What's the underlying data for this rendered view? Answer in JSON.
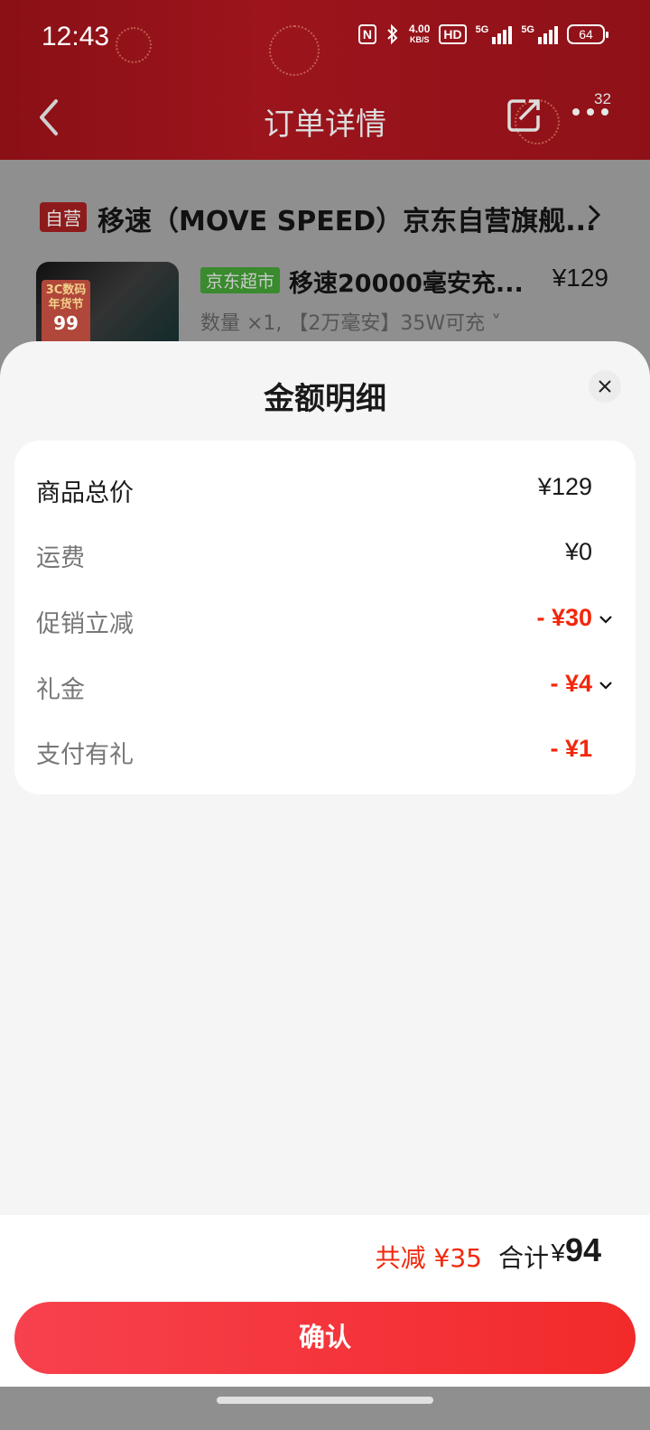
{
  "status_bar": {
    "time": "12:43",
    "nfc": "N",
    "speed_value": "4.00",
    "speed_unit": "KB/S",
    "hd": "HD",
    "sim1": "5G",
    "sim2": "5G",
    "battery": "64"
  },
  "nav": {
    "title": "订单详情",
    "badge": "32"
  },
  "order": {
    "shop_tag": "自营",
    "shop_name": "移速（MOVE SPEED）京东自营旗舰...",
    "product_tag": "京东超市",
    "product_name": "移速20000毫安充...",
    "product_price": "¥129",
    "product_spec": "数量 ×1, 【2万毫安】35W可充 ˅",
    "image_promo_text": "3C数码 年货节",
    "image_promo_number": "99"
  },
  "sheet": {
    "title": "金额明细",
    "rows": [
      {
        "label": "商品总价",
        "value": "¥129"
      },
      {
        "label": "运费",
        "value": "¥0"
      },
      {
        "label": "促销立减",
        "value": "- ¥30"
      },
      {
        "label": "礼金",
        "value": "- ¥4"
      },
      {
        "label": "支付有礼",
        "value": "- ¥1"
      }
    ],
    "total_saving": "共减 ¥35",
    "total_label": "合计",
    "total_currency": "¥",
    "total_amount": "94",
    "confirm_label": "确认"
  },
  "colors": {
    "accent_red": "#f2270c",
    "header_red": "#9c141c",
    "button_gradient_start": "#f7414e",
    "button_gradient_end": "#f22a2a"
  }
}
